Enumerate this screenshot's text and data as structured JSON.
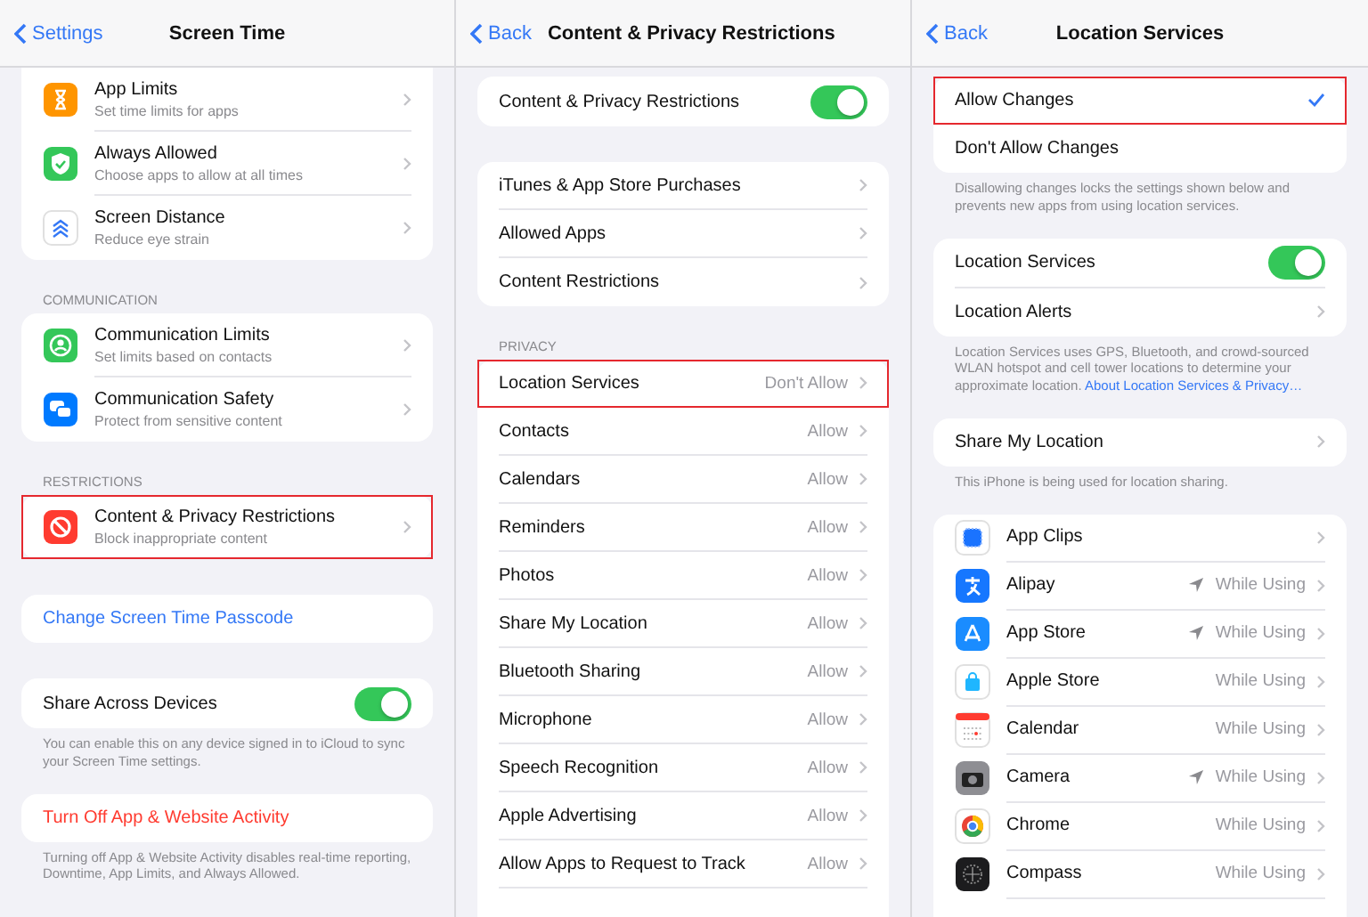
{
  "panels": [
    {
      "back": "Settings",
      "title": "Screen Time",
      "sections": [
        {
          "flat_top": true,
          "rows": [
            {
              "kind": "nav",
              "title": "App Limits",
              "subtitle": "Set time limits for apps",
              "highlighted": false
            },
            {
              "kind": "nav",
              "title": "Always Allowed",
              "subtitle": "Choose apps to allow at all times",
              "highlighted": false
            },
            {
              "kind": "nav",
              "title": "Screen Distance",
              "subtitle": "Reduce eye strain",
              "highlighted": false
            }
          ]
        },
        {
          "header": "COMMUNICATION",
          "rows": [
            {
              "kind": "nav",
              "title": "Communication Limits",
              "subtitle": "Set limits based on contacts",
              "highlighted": false
            },
            {
              "kind": "nav",
              "title": "Communication Safety",
              "subtitle": "Protect from sensitive content",
              "highlighted": false
            }
          ]
        },
        {
          "header": "RESTRICTIONS",
          "rows": [
            {
              "kind": "nav",
              "title": "Content & Privacy Restrictions",
              "subtitle": "Block inappropriate content",
              "highlighted": true
            }
          ]
        },
        {
          "rows": [
            {
              "kind": "link",
              "title": "Change Screen Time Passcode",
              "color": "#3478f6"
            }
          ]
        },
        {
          "rows": [
            {
              "kind": "toggle",
              "title": "Share Across Devices",
              "on": true
            }
          ],
          "footer": "You can enable this on any device signed in to iCloud to sync your Screen Time settings."
        },
        {
          "rows": [
            {
              "kind": "link",
              "title": "Turn Off App & Website Activity",
              "color": "#ff3b30"
            }
          ],
          "footer": "Turning off App & Website Activity disables real-time reporting, Downtime, App Limits, and Always Allowed."
        }
      ]
    },
    {
      "back": "Back",
      "title": "Content & Privacy Restrictions",
      "sections": [
        {
          "rows": [
            {
              "kind": "toggle",
              "title": "Content & Privacy Restrictions",
              "on": true
            }
          ]
        },
        {
          "rows": [
            {
              "kind": "value",
              "title": "iTunes & App Store Purchases",
              "highlighted": false
            },
            {
              "kind": "value",
              "title": "Allowed Apps",
              "highlighted": false
            },
            {
              "kind": "value",
              "title": "Content Restrictions",
              "highlighted": false
            }
          ]
        },
        {
          "header": "PRIVACY",
          "open_bottom": true,
          "rows": [
            {
              "kind": "value",
              "title": "Location Services",
              "value": "Don't Allow",
              "highlighted": true
            },
            {
              "kind": "value",
              "title": "Contacts",
              "value": "Allow",
              "highlighted": false
            },
            {
              "kind": "value",
              "title": "Calendars",
              "value": "Allow",
              "highlighted": false
            },
            {
              "kind": "value",
              "title": "Reminders",
              "value": "Allow",
              "highlighted": false
            },
            {
              "kind": "value",
              "title": "Photos",
              "value": "Allow",
              "highlighted": false
            },
            {
              "kind": "value",
              "title": "Share My Location",
              "value": "Allow",
              "highlighted": false
            },
            {
              "kind": "value",
              "title": "Bluetooth Sharing",
              "value": "Allow",
              "highlighted": false
            },
            {
              "kind": "value",
              "title": "Microphone",
              "value": "Allow",
              "highlighted": false
            },
            {
              "kind": "value",
              "title": "Speech Recognition",
              "value": "Allow",
              "highlighted": false
            },
            {
              "kind": "value",
              "title": "Apple Advertising",
              "value": "Allow",
              "highlighted": false
            },
            {
              "kind": "value",
              "title": "Allow Apps to Request to Track",
              "value": "Allow",
              "highlighted": false
            }
          ]
        }
      ]
    },
    {
      "back": "Back",
      "title": "Location Services",
      "sections": [
        {
          "rows": [
            {
              "kind": "check",
              "title": "Allow Changes",
              "selected": true,
              "highlighted": true
            },
            {
              "kind": "check",
              "title": "Don't Allow Changes",
              "selected": false,
              "highlighted": false
            }
          ],
          "footer": "Disallowing changes locks the settings shown below and prevents new apps from using location services."
        },
        {
          "rows": [
            {
              "kind": "toggle",
              "title": "Location Services",
              "on": true
            },
            {
              "kind": "value",
              "title": "Location Alerts",
              "highlighted": false
            }
          ],
          "footer": "Location Services uses GPS, Bluetooth, and crowd-sourced WLAN hotspot and cell tower locations to determine your approximate location.",
          "footer_link": "About Location Services & Privacy…"
        },
        {
          "rows": [
            {
              "kind": "value",
              "title": "Share My Location",
              "highlighted": false
            }
          ],
          "footer": "This iPhone is being used for location sharing."
        },
        {
          "open_bottom": true,
          "rows": [
            {
              "kind": "app",
              "title": "App Clips",
              "location_arrow": false
            },
            {
              "kind": "app",
              "title": "Alipay",
              "value": "While Using",
              "location_arrow": true
            },
            {
              "kind": "app",
              "title": "App Store",
              "value": "While Using",
              "location_arrow": true
            },
            {
              "kind": "app",
              "title": "Apple Store",
              "value": "While Using",
              "location_arrow": false
            },
            {
              "kind": "app",
              "title": "Calendar",
              "value": "While Using",
              "location_arrow": false
            },
            {
              "kind": "app",
              "title": "Camera",
              "value": "While Using",
              "location_arrow": true
            },
            {
              "kind": "app",
              "title": "Chrome",
              "value": "While Using",
              "location_arrow": false
            },
            {
              "kind": "app",
              "title": "Compass",
              "value": "While Using",
              "location_arrow": false
            }
          ]
        }
      ]
    }
  ]
}
